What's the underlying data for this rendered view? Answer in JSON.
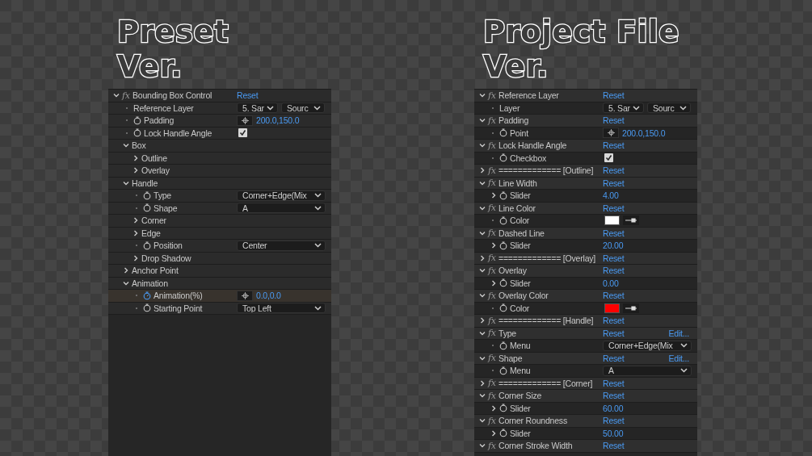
{
  "panels": [
    {
      "title_lines": [
        "Preset",
        "Ver."
      ],
      "rows": [
        {
          "kind": "effect",
          "badge": "fx",
          "label": "Bounding Box Control",
          "expanded": true,
          "reset": "Reset",
          "children": [
            {
              "kind": "property",
              "label": "Reference Layer",
              "stopwatch": false,
              "animated": false,
              "value": {
                "kind": "layer",
                "options": [
                  "5. Sar",
                  "Sourc"
                ]
              }
            },
            {
              "kind": "property",
              "label": "Padding",
              "stopwatch": true,
              "animated": false,
              "value": {
                "kind": "point",
                "text": "200.0,150.0"
              }
            },
            {
              "kind": "property",
              "label": "Lock Handle Angle",
              "stopwatch": true,
              "animated": false,
              "value": {
                "kind": "checkbox",
                "checked": true
              }
            },
            {
              "kind": "group",
              "label": "Box",
              "expanded": true,
              "children": [
                {
                  "kind": "group",
                  "label": "Outline",
                  "expanded": false
                },
                {
                  "kind": "group",
                  "label": "Overlay",
                  "expanded": false
                }
              ]
            },
            {
              "kind": "group",
              "label": "Handle",
              "expanded": true,
              "children": [
                {
                  "kind": "property",
                  "label": "Type",
                  "stopwatch": true,
                  "animated": false,
                  "value": {
                    "kind": "menu",
                    "text": "Corner+Edge(Mix"
                  }
                },
                {
                  "kind": "property",
                  "label": "Shape",
                  "stopwatch": true,
                  "animated": false,
                  "value": {
                    "kind": "menu",
                    "text": "A"
                  }
                },
                {
                  "kind": "group",
                  "label": "Corner",
                  "expanded": false
                },
                {
                  "kind": "group",
                  "label": "Edge",
                  "expanded": false
                },
                {
                  "kind": "property",
                  "label": "Position",
                  "stopwatch": true,
                  "animated": false,
                  "value": {
                    "kind": "menu",
                    "text": "Center"
                  }
                },
                {
                  "kind": "group",
                  "label": "Drop Shadow",
                  "expanded": false
                }
              ]
            },
            {
              "kind": "group",
              "label": "Anchor Point",
              "expanded": false
            },
            {
              "kind": "group",
              "label": "Animation",
              "expanded": true,
              "children": [
                {
                  "kind": "property",
                  "label": "Animation(%)",
                  "stopwatch": true,
                  "animated": true,
                  "value": {
                    "kind": "point",
                    "text": "0.0,0.0"
                  }
                },
                {
                  "kind": "property",
                  "label": "Starting Point",
                  "stopwatch": true,
                  "animated": false,
                  "value": {
                    "kind": "menu",
                    "text": "Top Left"
                  }
                }
              ]
            }
          ]
        }
      ]
    },
    {
      "title_lines": [
        "Project File",
        "Ver."
      ],
      "rows": [
        {
          "kind": "effect",
          "badge": "fx",
          "label": "Reference Layer",
          "expanded": true,
          "reset": "Reset",
          "children": [
            {
              "kind": "property",
              "label": "Layer",
              "stopwatch": false,
              "animated": false,
              "value": {
                "kind": "layer",
                "options": [
                  "5. Sar",
                  "Sourc"
                ]
              }
            }
          ]
        },
        {
          "kind": "effect",
          "badge": "fx",
          "label": "Padding",
          "expanded": true,
          "reset": "Reset",
          "children": [
            {
              "kind": "property",
              "label": "Point",
              "stopwatch": true,
              "animated": false,
              "value": {
                "kind": "point",
                "text": "200.0,150.0"
              }
            }
          ]
        },
        {
          "kind": "effect",
          "badge": "fx",
          "label": "Lock Handle Angle",
          "expanded": true,
          "reset": "Reset",
          "children": [
            {
              "kind": "property",
              "label": "Checkbox",
              "stopwatch": true,
              "animated": false,
              "value": {
                "kind": "checkbox",
                "checked": true
              }
            }
          ]
        },
        {
          "kind": "effect",
          "badge": "fx",
          "label": "============= [Outline]",
          "expanded": false,
          "reset": "Reset"
        },
        {
          "kind": "effect",
          "badge": "fx",
          "label": "Line Width",
          "expanded": true,
          "reset": "Reset",
          "children": [
            {
              "kind": "property",
              "label": "Slider",
              "expanded": false,
              "stopwatch": true,
              "animated": false,
              "value": {
                "kind": "number",
                "text": "4.00"
              }
            }
          ]
        },
        {
          "kind": "effect",
          "badge": "fx",
          "label": "Line Color",
          "expanded": true,
          "reset": "Reset",
          "children": [
            {
              "kind": "property",
              "label": "Color",
              "stopwatch": true,
              "animated": false,
              "value": {
                "kind": "color",
                "color": "#ffffff"
              }
            }
          ]
        },
        {
          "kind": "effect",
          "badge": "fx",
          "label": "Dashed Line",
          "expanded": true,
          "reset": "Reset",
          "children": [
            {
              "kind": "property",
              "label": "Slider",
              "expanded": false,
              "stopwatch": true,
              "animated": false,
              "value": {
                "kind": "number",
                "text": "20.00"
              }
            }
          ]
        },
        {
          "kind": "effect",
          "badge": "fx",
          "label": "============= [Overlay]",
          "expanded": false,
          "reset": "Reset"
        },
        {
          "kind": "effect",
          "badge": "fx",
          "label": "Overlay",
          "expanded": true,
          "reset": "Reset",
          "children": [
            {
              "kind": "property",
              "label": "Slider",
              "expanded": false,
              "stopwatch": true,
              "animated": false,
              "value": {
                "kind": "number",
                "text": "0.00"
              }
            }
          ]
        },
        {
          "kind": "effect",
          "badge": "fx",
          "label": "Overlay Color",
          "expanded": true,
          "reset": "Reset",
          "children": [
            {
              "kind": "property",
              "label": "Color",
              "stopwatch": true,
              "animated": false,
              "value": {
                "kind": "color",
                "color": "#ff0000"
              }
            }
          ]
        },
        {
          "kind": "effect",
          "badge": "fx",
          "label": "============= [Handle]",
          "expanded": false,
          "reset": "Reset"
        },
        {
          "kind": "effect",
          "badge": "fx",
          "label": "Type",
          "expanded": true,
          "reset": "Reset",
          "edit": "Edit...",
          "children": [
            {
              "kind": "property",
              "label": "Menu",
              "stopwatch": true,
              "animated": false,
              "value": {
                "kind": "menu",
                "text": "Corner+Edge(Mix"
              }
            }
          ]
        },
        {
          "kind": "effect",
          "badge": "fx",
          "label": "Shape",
          "expanded": true,
          "reset": "Reset",
          "edit": "Edit...",
          "children": [
            {
              "kind": "property",
              "label": "Menu",
              "stopwatch": true,
              "animated": false,
              "value": {
                "kind": "menu",
                "text": "A"
              }
            }
          ]
        },
        {
          "kind": "effect",
          "badge": "fx",
          "label": "============= [Corner]",
          "expanded": false,
          "reset": "Reset"
        },
        {
          "kind": "effect",
          "badge": "fx",
          "label": "Corner Size",
          "expanded": true,
          "reset": "Reset",
          "children": [
            {
              "kind": "property",
              "label": "Slider",
              "expanded": false,
              "stopwatch": true,
              "animated": false,
              "value": {
                "kind": "number",
                "text": "60.00"
              }
            }
          ]
        },
        {
          "kind": "effect",
          "badge": "fx",
          "label": "Corner Roundness",
          "expanded": true,
          "reset": "Reset",
          "children": [
            {
              "kind": "property",
              "label": "Slider",
              "expanded": false,
              "stopwatch": true,
              "animated": false,
              "value": {
                "kind": "number",
                "text": "50.00"
              }
            }
          ]
        },
        {
          "kind": "effect",
          "badge": "fx",
          "label": "Corner Stroke Width",
          "expanded": true,
          "reset": "Reset"
        }
      ]
    }
  ]
}
